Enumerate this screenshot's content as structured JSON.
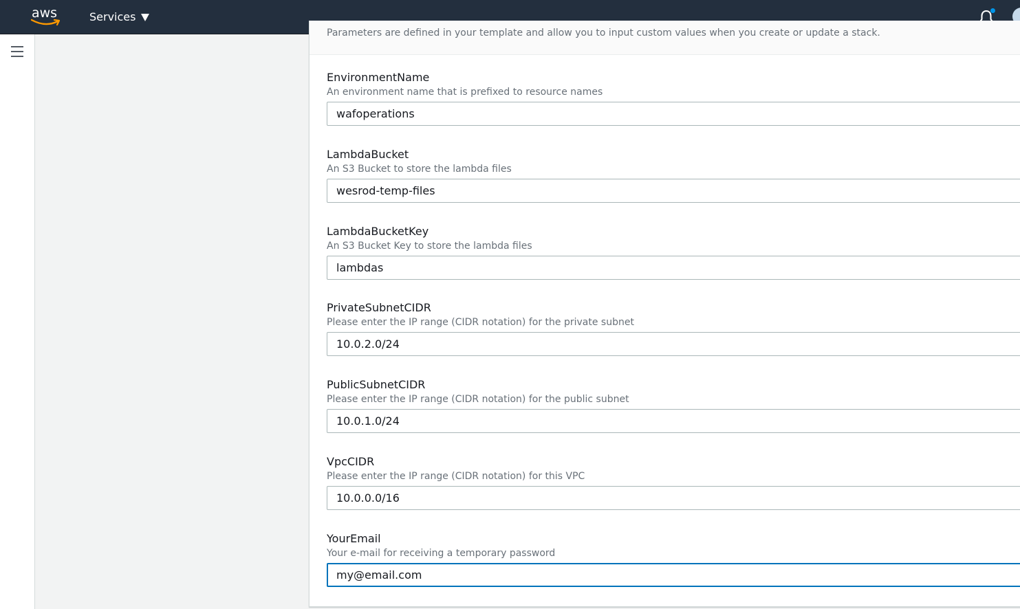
{
  "topbar": {
    "logo_text": "aws",
    "services_label": "Services",
    "notification_unread": true
  },
  "panel": {
    "description": "Parameters are defined in your template and allow you to input custom values when you create or update a stack."
  },
  "parameters": [
    {
      "name": "EnvironmentName",
      "description": "An environment name that is prefixed to resource names",
      "value": "wafoperations"
    },
    {
      "name": "LambdaBucket",
      "description": "An S3 Bucket to store the lambda files",
      "value": "wesrod-temp-files"
    },
    {
      "name": "LambdaBucketKey",
      "description": "An S3 Bucket Key to store the lambda files",
      "value": "lambdas"
    },
    {
      "name": "PrivateSubnetCIDR",
      "description": "Please enter the IP range (CIDR notation) for the private subnet",
      "value": "10.0.2.0/24"
    },
    {
      "name": "PublicSubnetCIDR",
      "description": "Please enter the IP range (CIDR notation) for the public subnet",
      "value": "10.0.1.0/24"
    },
    {
      "name": "VpcCIDR",
      "description": "Please enter the IP range (CIDR notation) for this VPC",
      "value": "10.0.0.0/16"
    },
    {
      "name": "YourEmail",
      "description": "Your e-mail for receiving a temporary password",
      "value": "my@email.com"
    }
  ],
  "colors": {
    "header_bg": "#232f3e",
    "focus_border": "#0073bb",
    "notification_dot": "#0095e8"
  },
  "icons": [
    "aws-logo",
    "chevron-down-icon",
    "bell-icon",
    "hamburger-menu-icon"
  ]
}
